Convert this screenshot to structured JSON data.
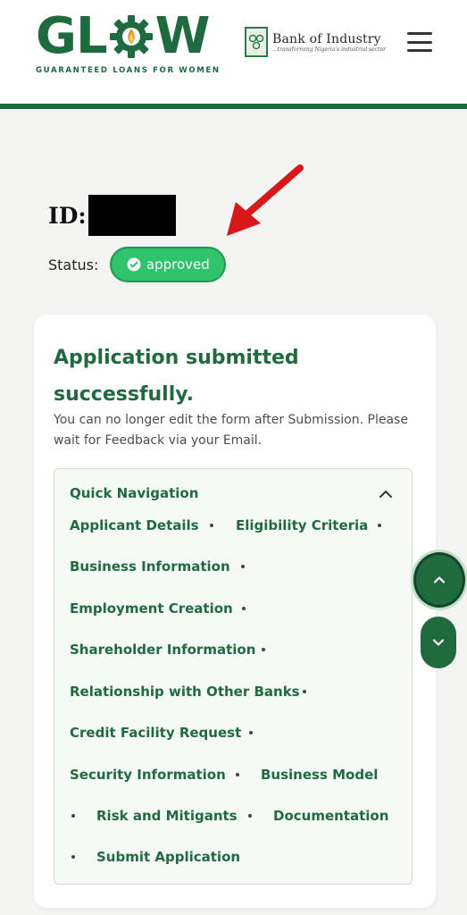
{
  "header": {
    "logo_text_left": "GL",
    "logo_text_right": "W",
    "logo_tagline": "GUARANTEED LOANS FOR WOMEN",
    "partner_name": "Bank of Industry",
    "partner_tagline": "...transforming Nigeria's industrial sector"
  },
  "application": {
    "id_label": "ID:",
    "status_label": "Status:",
    "status_value": "approved"
  },
  "card": {
    "title": "Application submitted successfully.",
    "note": "You can no longer edit the form after Submission. Please wait for Feedback via your Email."
  },
  "quick_nav": {
    "heading": "Quick Navigation",
    "items": [
      "Applicant Details",
      "Eligibility Criteria",
      "Business Information",
      "Employment Creation",
      "Shareholder Information",
      "Relationship with Other Banks",
      "Credit Facility Request",
      "Security Information",
      "Business Model",
      "Risk and Mitigants",
      "Documentation",
      "Submit Application"
    ]
  },
  "colors": {
    "brand_green": "#1d6b3e",
    "status_green": "#2fc36b",
    "annotation_red": "#d81818"
  },
  "icons": {
    "menu": "hamburger-menu-icon",
    "status": "check-circle-icon",
    "collapse": "chevron-up-icon",
    "scroll_up": "chevron-up-icon",
    "scroll_down": "chevron-down-icon",
    "annotation": "red-arrow-icon"
  }
}
